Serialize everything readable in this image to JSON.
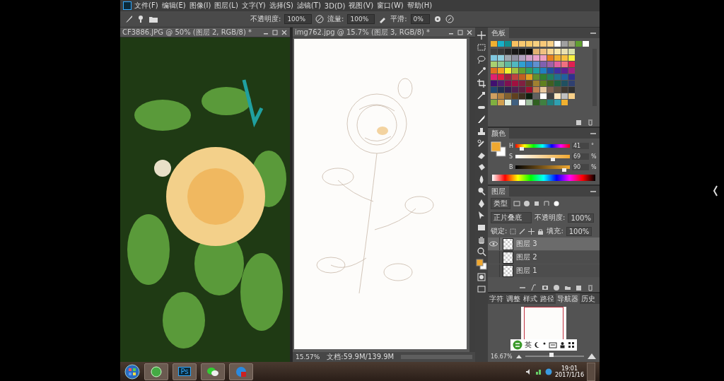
{
  "menu": [
    "文件(F)",
    "编辑(E)",
    "图像(I)",
    "图层(L)",
    "文字(Y)",
    "选择(S)",
    "滤镜(T)",
    "3D(D)",
    "视图(V)",
    "窗口(W)",
    "帮助(H)"
  ],
  "options_bar": {
    "opacity_label": "不透明度:",
    "opacity": "100%",
    "flow_label": "流量:",
    "flow": "100%",
    "smoothing_label": "平滑:",
    "smoothing": "0%"
  },
  "documents": [
    {
      "kind": "photo",
      "title": "CF3886.JPG @ 50% (图层 2, RGB/8) *"
    },
    {
      "kind": "sketch",
      "title": "img762.jpg @ 15.7% (图层 3, RGB/8) *",
      "zoom": "15.57%",
      "doc_size": "文档:59.9M/139.9M"
    }
  ],
  "swatches": {
    "title": "色板",
    "recent": [
      {
        "color": "#f0b030"
      },
      {
        "color": "#18b0c8"
      },
      {
        "color": "#109090"
      },
      {
        "color": "#f8c060"
      },
      {
        "color": "#f8c870"
      },
      {
        "color": "#f8c868"
      },
      {
        "color": "#f8d080"
      },
      {
        "color": "#f8c878"
      },
      {
        "color": "#f8d088"
      },
      {
        "color": "#ffffff"
      },
      {
        "color": "#a0a0a0"
      },
      {
        "color": "#a0a080"
      },
      {
        "color": "#60a030"
      },
      {
        "color": "#ffffff"
      }
    ],
    "rows": [
      {
        "swatches": [
          {
            "color": "#404040"
          },
          {
            "color": "#383838"
          },
          {
            "color": "#282828"
          },
          {
            "color": "#181818"
          },
          {
            "color": "#101010"
          },
          {
            "color": "#080808"
          },
          {
            "color": "#e0b070"
          },
          {
            "color": "#f0c080"
          },
          {
            "color": "#f8d890"
          },
          {
            "color": "#f8e8a8"
          },
          {
            "color": "#e8e0b0"
          },
          {
            "color": "#d8e0a8"
          }
        ]
      },
      {
        "swatches": [
          {
            "color": "#80c8e0"
          },
          {
            "color": "#90d0e0"
          },
          {
            "color": "#a0a8b0"
          },
          {
            "color": "#9090a0"
          },
          {
            "color": "#b0a0c0"
          },
          {
            "color": "#d0a0c8"
          },
          {
            "color": "#e8a0c8"
          },
          {
            "color": "#f0a0c0"
          },
          {
            "color": "#e88020"
          },
          {
            "color": "#f0b030"
          },
          {
            "color": "#f8c040"
          },
          {
            "color": "#f8f040"
          }
        ]
      },
      {
        "swatches": [
          {
            "color": "#a8d070"
          },
          {
            "color": "#90c890"
          },
          {
            "color": "#60b8a0"
          },
          {
            "color": "#50b8c0"
          },
          {
            "color": "#30a0d0"
          },
          {
            "color": "#3080c8"
          },
          {
            "color": "#6090d0"
          },
          {
            "color": "#8060b0"
          },
          {
            "color": "#a060a8"
          },
          {
            "color": "#e060a0"
          },
          {
            "color": "#f07080"
          },
          {
            "color": "#e02050"
          }
        ]
      },
      {
        "swatches": [
          {
            "color": "#e07020"
          },
          {
            "color": "#f0a020"
          },
          {
            "color": "#f0f030"
          },
          {
            "color": "#a0c040"
          },
          {
            "color": "#60a030"
          },
          {
            "color": "#30a060"
          },
          {
            "color": "#20a0a0"
          },
          {
            "color": "#2080c0"
          },
          {
            "color": "#2050a0"
          },
          {
            "color": "#4030a0"
          },
          {
            "color": "#602090"
          },
          {
            "color": "#a02080"
          }
        ]
      },
      {
        "swatches": [
          {
            "color": "#e02070"
          },
          {
            "color": "#e02040"
          },
          {
            "color": "#a02040"
          },
          {
            "color": "#c04040"
          },
          {
            "color": "#c06020"
          },
          {
            "color": "#e0a020"
          },
          {
            "color": "#609030"
          },
          {
            "color": "#308030"
          },
          {
            "color": "#208060"
          },
          {
            "color": "#207090"
          },
          {
            "color": "#2060a0"
          },
          {
            "color": "#303090"
          }
        ]
      },
      {
        "swatches": [
          {
            "color": "#401070"
          },
          {
            "color": "#502070"
          },
          {
            "color": "#801050"
          },
          {
            "color": "#a01040"
          },
          {
            "color": "#802040"
          },
          {
            "color": "#604020"
          },
          {
            "color": "#a08030"
          },
          {
            "color": "#608020"
          },
          {
            "color": "#406020"
          },
          {
            "color": "#206040"
          },
          {
            "color": "#205060"
          },
          {
            "color": "#304070"
          }
        ]
      },
      {
        "swatches": [
          {
            "color": "#204870"
          },
          {
            "color": "#203050"
          },
          {
            "color": "#302050"
          },
          {
            "color": "#502050"
          },
          {
            "color": "#602040"
          },
          {
            "color": "#a01030"
          },
          {
            "color": "#c08050"
          },
          {
            "color": "#e8c8a0"
          },
          {
            "color": "#806050"
          },
          {
            "color": "#605040"
          },
          {
            "color": "#403830"
          },
          {
            "color": "#303030"
          }
        ]
      },
      {
        "swatches": [
          {
            "color": "#d0a060"
          },
          {
            "color": "#b08040"
          },
          {
            "color": "#806030"
          },
          {
            "color": "#604020"
          },
          {
            "color": "#403020"
          },
          {
            "color": "#102010"
          },
          {
            "color": "#606060"
          },
          {
            "color": "#ffffff"
          },
          {
            "color": "#404040"
          },
          {
            "color": "#ffe8c0"
          },
          {
            "color": "#c0c0c0"
          },
          {
            "color": "#f8d088"
          }
        ]
      },
      {
        "swatches": [
          {
            "color": "#80b040"
          },
          {
            "color": "#d0a050"
          },
          {
            "color": "#e0f0e0"
          },
          {
            "color": "#406080"
          },
          {
            "color": "#ffffff"
          },
          {
            "color": "#a0c0a0"
          },
          {
            "color": "#306020"
          },
          {
            "color": "#408040"
          },
          {
            "color": "#208080"
          },
          {
            "color": "#30a0b0"
          },
          {
            "color": "#f0b030"
          }
        ]
      }
    ]
  },
  "color_panel": {
    "title": "颜色",
    "foreground": {
      "color": "#f0a830"
    },
    "sliders": [
      {
        "kind": "hue",
        "label": "H",
        "value": "41",
        "unit": "°",
        "level": 0.12
      },
      {
        "kind": "saturation",
        "label": "S",
        "value": "69",
        "unit": "%",
        "level": 0.69
      },
      {
        "kind": "brightness",
        "label": "B",
        "value": "90",
        "unit": "%",
        "level": 0.9
      }
    ]
  },
  "layers": {
    "title": "图层",
    "filter": "类型",
    "blend_mode": "正片叠底",
    "opacity_label": "不透明度:",
    "opacity": "100%",
    "lock_label": "锁定:",
    "fill_label": "填充:",
    "fill": "100%",
    "items": [
      {
        "name": "图层 3",
        "visible": true,
        "selected": true
      },
      {
        "name": "图层 2",
        "visible": false,
        "selected": false
      },
      {
        "name": "图层 1",
        "visible": false,
        "selected": false
      }
    ]
  },
  "bottom_tabs": [
    {
      "label": "字符",
      "selected": false
    },
    {
      "label": "调整",
      "selected": false
    },
    {
      "label": "样式",
      "selected": false
    },
    {
      "label": "路径",
      "selected": false
    },
    {
      "label": "导航器",
      "selected": true
    },
    {
      "label": "历史",
      "selected": false
    }
  ],
  "navigator": {
    "zoom": "16.67%",
    "level": 0.45
  },
  "ime": {
    "label": "英"
  },
  "taskbar": {
    "apps": [
      {
        "kind": "green-circle"
      },
      {
        "kind": "photoshop",
        "label": "Ps"
      },
      {
        "kind": "chat"
      },
      {
        "kind": "browser"
      }
    ],
    "time": "19:01",
    "date": "2017/1/16"
  }
}
